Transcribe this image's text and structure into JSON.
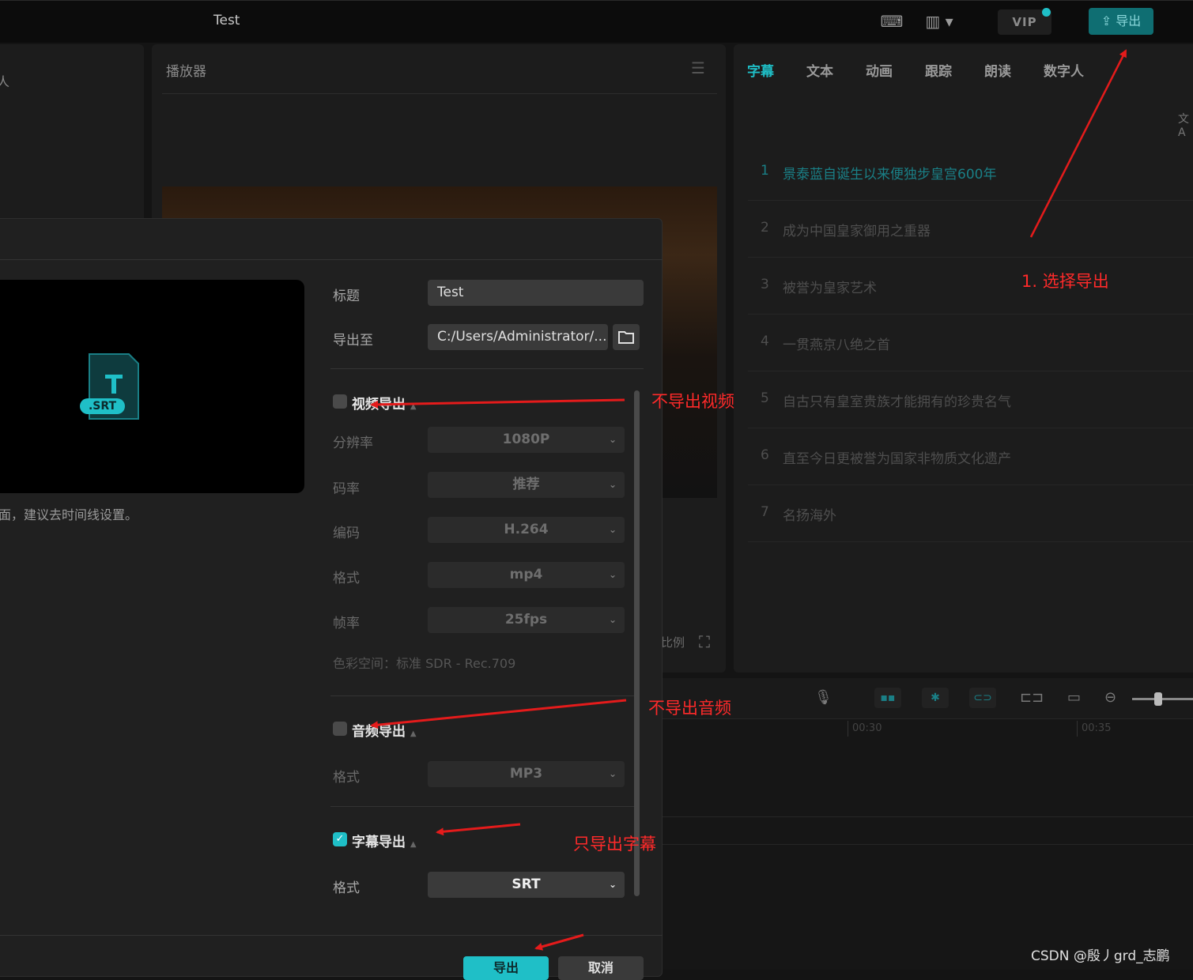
{
  "app": {
    "title": "Test",
    "vip_label": "VIP",
    "export_label": "导出"
  },
  "left_panel": {
    "label": "人"
  },
  "player": {
    "title": "播放器",
    "aspect_label": "比例"
  },
  "right_panel": {
    "tabs": [
      "字幕",
      "文本",
      "动画",
      "跟踪",
      "朗读",
      "数字人"
    ],
    "translate_icon_text": "文A",
    "subtitles": [
      {
        "num": "1",
        "text": "景泰蓝自诞生以来便独步皇宫600年"
      },
      {
        "num": "2",
        "text": "成为中国皇家御用之重器"
      },
      {
        "num": "3",
        "text": "被誉为皇家艺术"
      },
      {
        "num": "4",
        "text": "一贯燕京八绝之首"
      },
      {
        "num": "5",
        "text": "自古只有皇室贵族才能拥有的珍贵名气"
      },
      {
        "num": "6",
        "text": "直至今日更被誉为国家非物质文化遗产"
      },
      {
        "num": "7",
        "text": "名扬海外"
      }
    ]
  },
  "timeline": {
    "time_labels": [
      "00:30",
      "00:35"
    ]
  },
  "dialog": {
    "preview_badge": ".SRT",
    "preview_letter": "T",
    "hint": "面，建议去时间线设置。",
    "title_label": "标题",
    "title_value": "Test",
    "export_to_label": "导出至",
    "export_path": "C:/Users/Administrator/...",
    "video_section": {
      "title": "视频导出",
      "checked": false,
      "fields": [
        {
          "label": "分辨率",
          "value": "1080P"
        },
        {
          "label": "码率",
          "value": "推荐"
        },
        {
          "label": "编码",
          "value": "H.264"
        },
        {
          "label": "格式",
          "value": "mp4"
        },
        {
          "label": "帧率",
          "value": "25fps"
        }
      ],
      "color_space": "色彩空间：标准 SDR - Rec.709"
    },
    "audio_section": {
      "title": "音频导出",
      "checked": false,
      "format_label": "格式",
      "format_value": "MP3"
    },
    "subtitle_section": {
      "title": "字幕导出",
      "checked": true,
      "format_label": "格式",
      "format_value": "SRT"
    },
    "export_button": "导出",
    "cancel_button": "取消"
  },
  "annotations": {
    "step1": "1. 选择导出",
    "no_video": "不导出视频",
    "no_audio": "不导出音频",
    "only_subtitle": "只导出字幕"
  },
  "watermark": "CSDN @殷丿grd_志鹏",
  "colors": {
    "accent": "#1fbfc7",
    "annotation": "#ff2a2a",
    "background": "#141414"
  }
}
